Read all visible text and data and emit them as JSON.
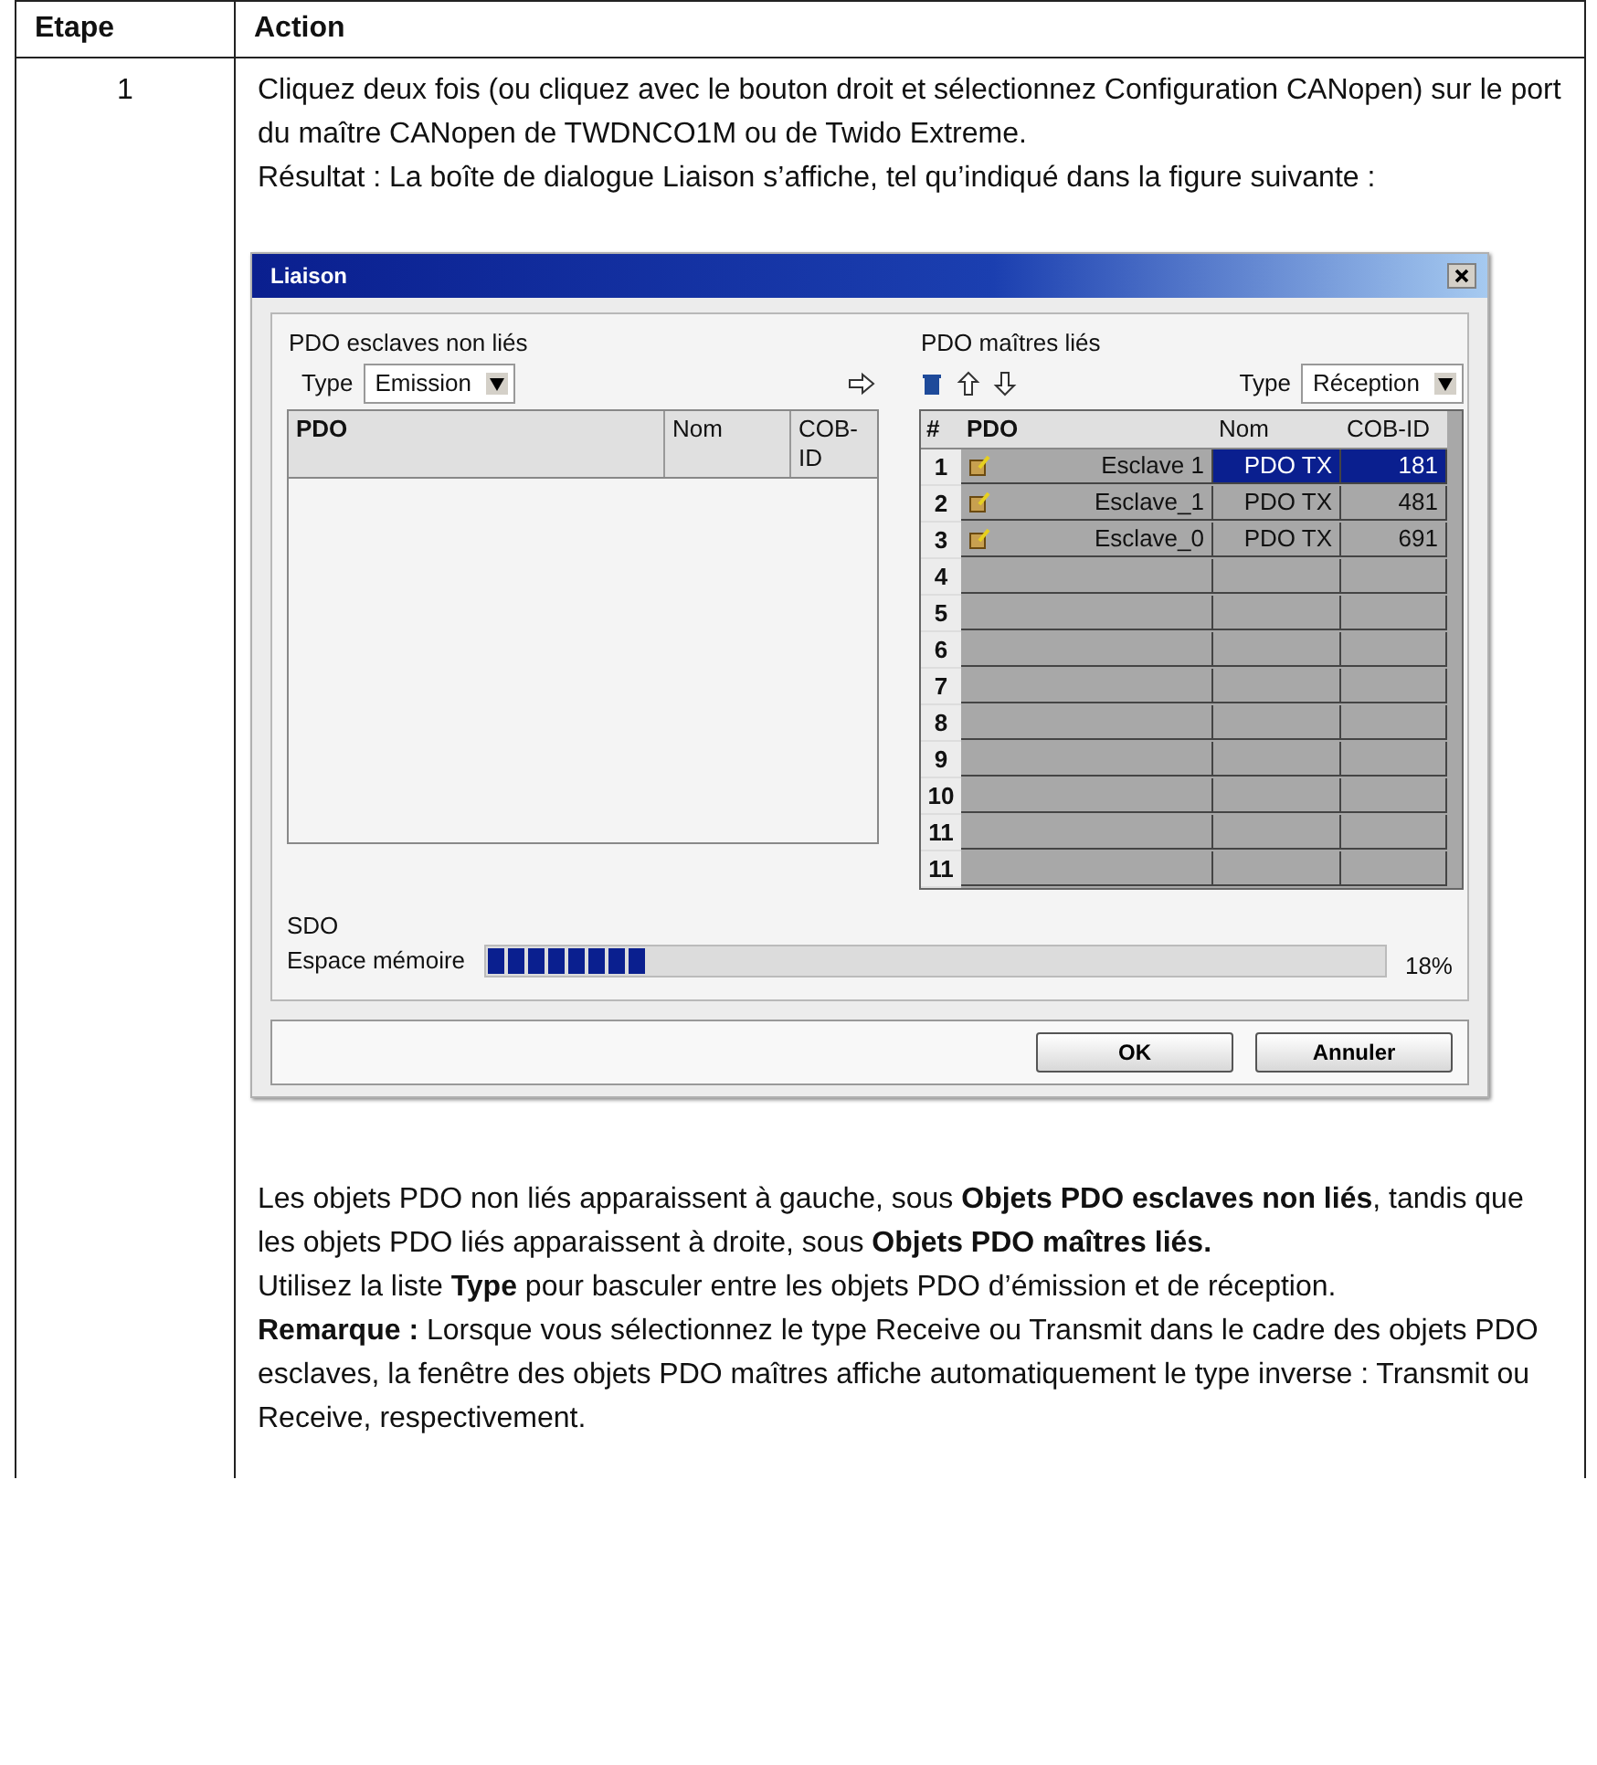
{
  "table": {
    "columns": [
      "Etape",
      "Action"
    ],
    "rows": [
      {
        "step": "1",
        "paragraphs_before": [
          "Cliquez deux fois (ou cliquez avec le bouton droit et sélectionnez Configuration CANopen) sur le port du maître CANopen de TWDNCO1M ou de Twido Extreme.",
          "Résultat : La boîte de dialogue Liaison s’affiche, tel qu’indiqué dans la figure suivante :"
        ],
        "dialog": {
          "title": "Liaison",
          "left": {
            "title": "PDO esclaves non liés",
            "type_label": "Type",
            "type_value": "Emission",
            "columns": [
              "PDO",
              "Nom",
              "COB-ID"
            ]
          },
          "right": {
            "title": "PDO maîtres liés",
            "type_label": "Type",
            "type_value": "Réception",
            "columns": [
              "#",
              "PDO",
              "Nom",
              "COB-ID"
            ],
            "rows": [
              {
                "num": "1",
                "pdo": "Esclave 1",
                "nom": "PDO TX",
                "cob_id": "181",
                "selected": true
              },
              {
                "num": "2",
                "pdo": "Esclave_1",
                "nom": "PDO TX",
                "cob_id": "481",
                "selected": false
              },
              {
                "num": "3",
                "pdo": "Esclave_0",
                "nom": "PDO TX",
                "cob_id": "691",
                "selected": false
              },
              {
                "num": "4",
                "selected": false
              },
              {
                "num": "5",
                "selected": false
              },
              {
                "num": "6",
                "selected": false
              },
              {
                "num": "7",
                "selected": false
              },
              {
                "num": "8",
                "selected": false
              },
              {
                "num": "9",
                "selected": false
              },
              {
                "num": "10",
                "selected": false
              },
              {
                "num": "11",
                "selected": false
              },
              {
                "num": "11",
                "selected": false
              }
            ]
          },
          "sdo": {
            "label": "SDO",
            "memory_label": "Espace mémoire",
            "level": 0.18,
            "reading": "18%"
          },
          "buttons": [
            "OK",
            "Annuler"
          ]
        },
        "paragraphs_after": [
          "Les objets PDO non liés apparaissent à gauche, sous **Objets PDO esclaves non liés**, tandis que les objets PDO liés apparaissent à droite, sous **Objets PDO maîtres liés.**",
          "Utilisez la liste **Type** pour basculer entre les objets PDO d’émission et de réception.",
          "**Remarque :** Lorsque vous sélectionnez le type Receive ou Transmit dans le cadre des objets PDO esclaves, la fenêtre des objets PDO maîtres affiche automatiquement le type inverse : Transmit ou Receive, respectivement."
        ]
      }
    ]
  }
}
